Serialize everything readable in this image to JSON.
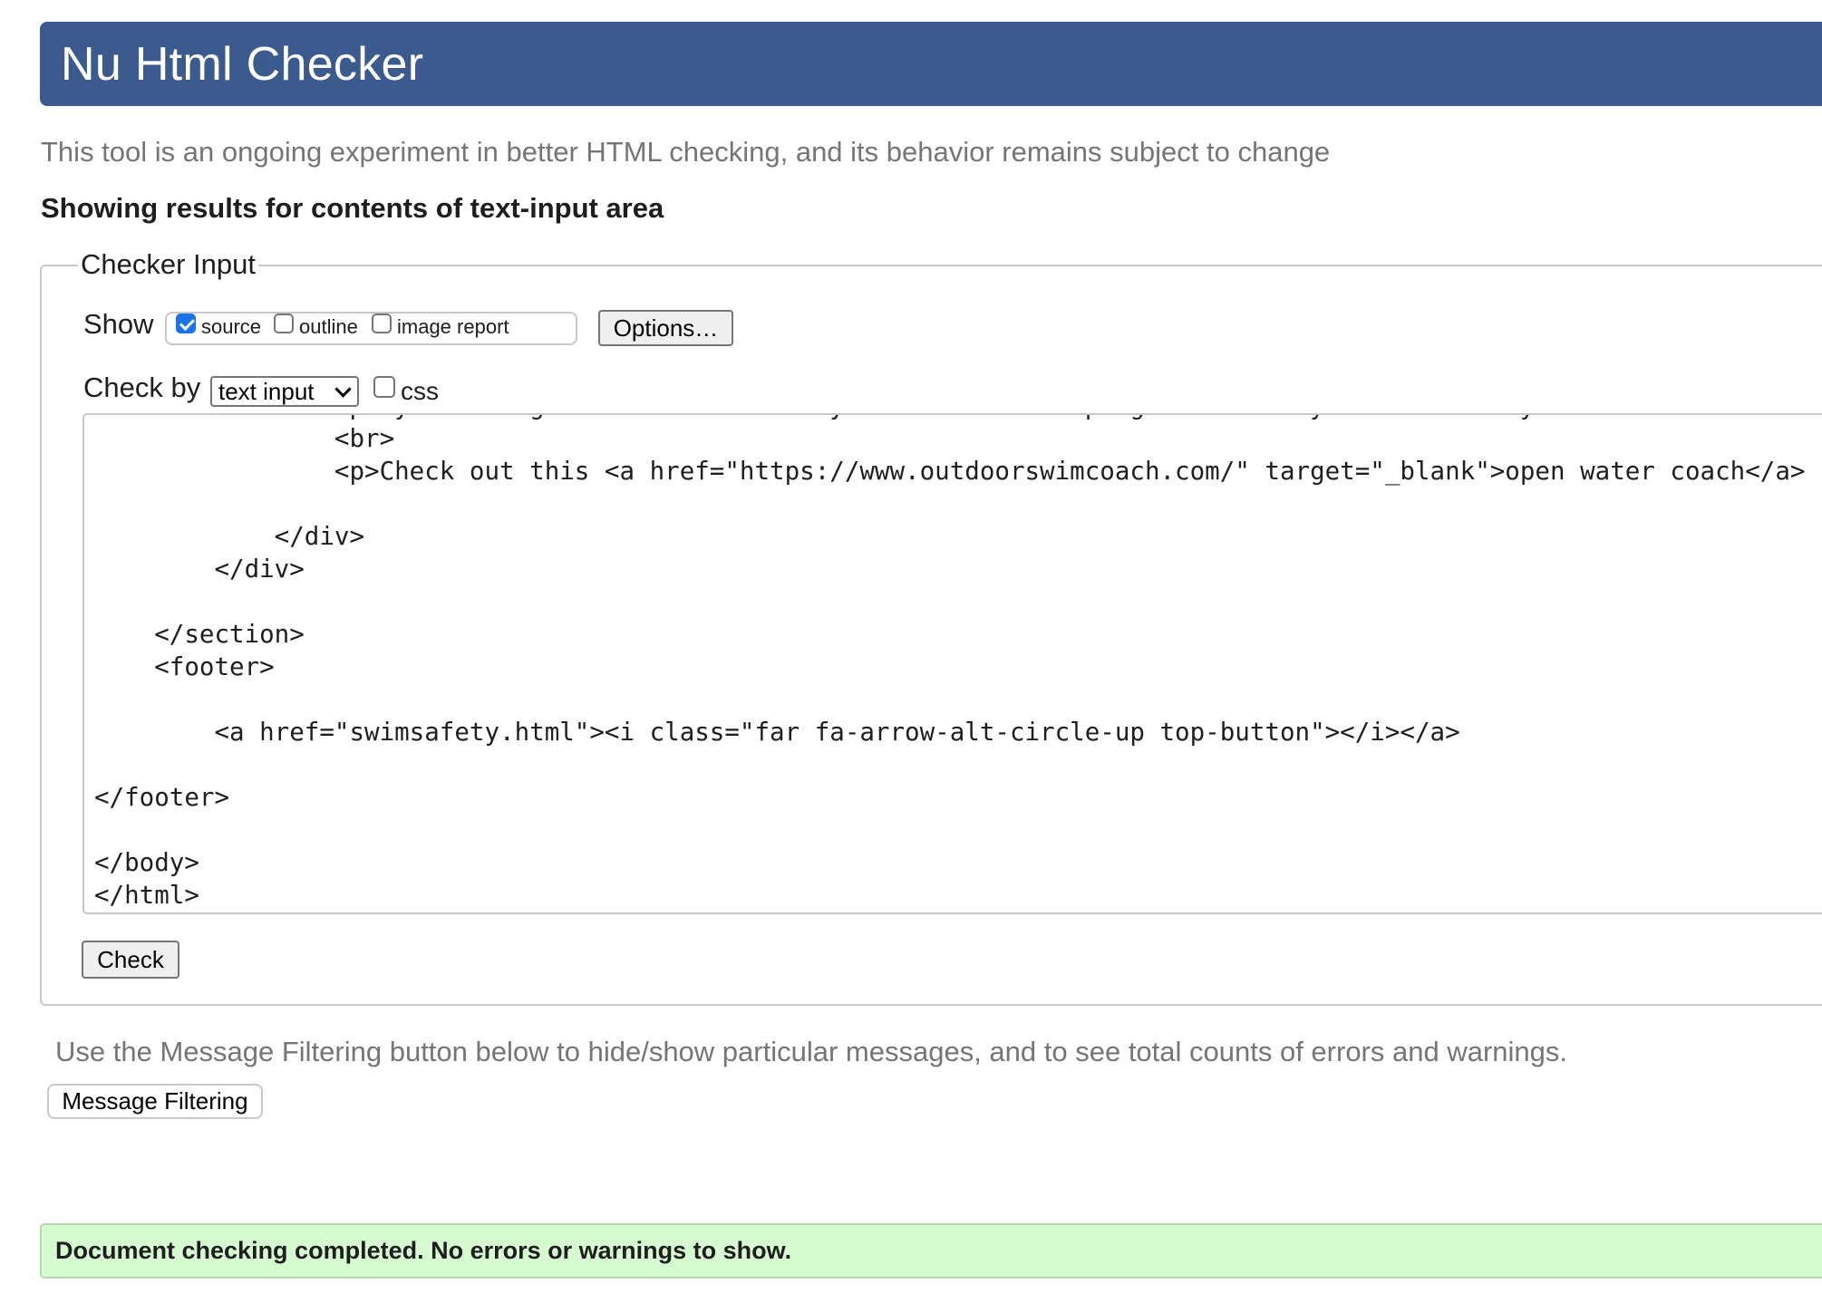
{
  "header": {
    "title": "Nu Html Checker"
  },
  "intro_text": "This tool is an ongoing experiment in better HTML checking, and its behavior remains subject to change",
  "results_heading": "Showing results for contents of text-input area",
  "checker_input": {
    "legend": "Checker Input",
    "show_label": "Show",
    "show_options": [
      {
        "label": "source",
        "checked": true
      },
      {
        "label": "outline",
        "checked": false
      },
      {
        "label": "image report",
        "checked": false
      }
    ],
    "options_button": "Options…",
    "check_by_label": "Check by",
    "check_by_select": {
      "selected": "text input"
    },
    "css_checkbox": {
      "label": "css",
      "checked": false
    },
    "source_text": "                <p>by checking conditions before your swim and keeping safe with your swim buddy. We also have a tips page</p>\n                <br>\n                <p>Check out this <a href=\"https://www.outdoorswimcoach.com/\" target=\"_blank\">open water coach</a> based in</p>\n\n            </div>\n        </div>\n\n    </section>\n    <footer>\n\n        <a href=\"swimsafety.html\"><i class=\"far fa-arrow-alt-circle-up top-button\"></i></a>\n\n</footer>\n\n</body>\n</html>",
    "check_button": "Check"
  },
  "filtering": {
    "note": "Use the Message Filtering button below to hide/show particular messages, and to see total counts of errors and warnings.",
    "button": "Message Filtering"
  },
  "result_message": "Document checking completed. No errors or warnings to show.",
  "colors": {
    "header_bg": "#3b5b8e",
    "success_bg": "#d6fbd1",
    "checkbox_checked": "#1a73e8"
  }
}
